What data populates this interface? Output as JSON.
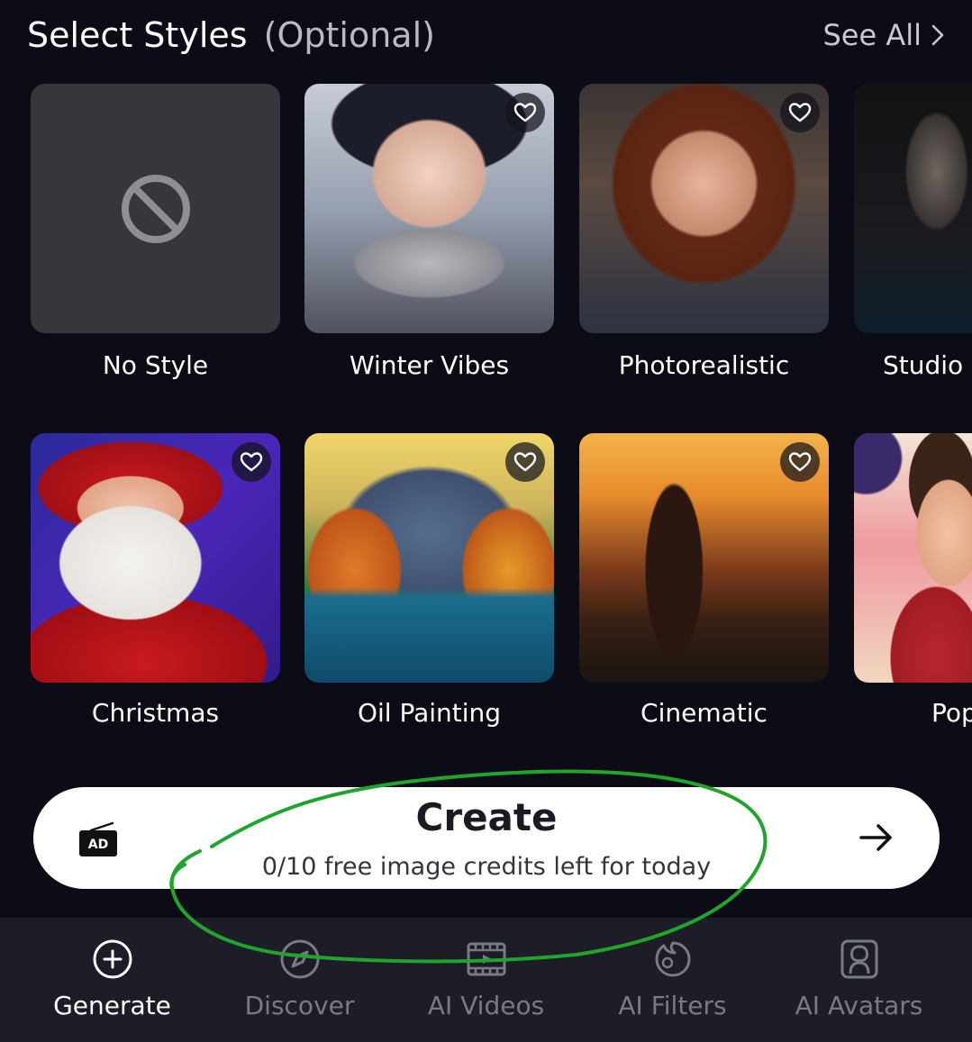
{
  "header": {
    "title": "Select Styles",
    "title_optional": "(Optional)",
    "see_all_label": "See All"
  },
  "styles_row1": [
    {
      "label": "No Style",
      "favorite": false
    },
    {
      "label": "Winter Vibes",
      "favorite": true
    },
    {
      "label": "Photorealistic",
      "favorite": true
    },
    {
      "label": "Studio",
      "favorite": false
    }
  ],
  "styles_row2": [
    {
      "label": "Christmas",
      "favorite": true
    },
    {
      "label": "Oil Painting",
      "favorite": true
    },
    {
      "label": "Cinematic",
      "favorite": true
    },
    {
      "label": "Pop",
      "favorite": false
    }
  ],
  "create": {
    "ad_badge": "AD",
    "title": "Create",
    "subtitle": "0/10 free image credits left for today"
  },
  "nav": {
    "items": [
      {
        "label": "Generate",
        "icon": "plus-circle-icon",
        "active": true
      },
      {
        "label": "Discover",
        "icon": "compass-icon",
        "active": false
      },
      {
        "label": "AI Videos",
        "icon": "film-icon",
        "active": false
      },
      {
        "label": "AI Filters",
        "icon": "filter-face-icon",
        "active": false
      },
      {
        "label": "AI Avatars",
        "icon": "avatar-icon",
        "active": false
      }
    ]
  },
  "colors": {
    "background": "#0b0c16",
    "nav_background": "#1c1d27",
    "annotation_green": "#1fa52b",
    "inactive_nav": "#787a86"
  }
}
